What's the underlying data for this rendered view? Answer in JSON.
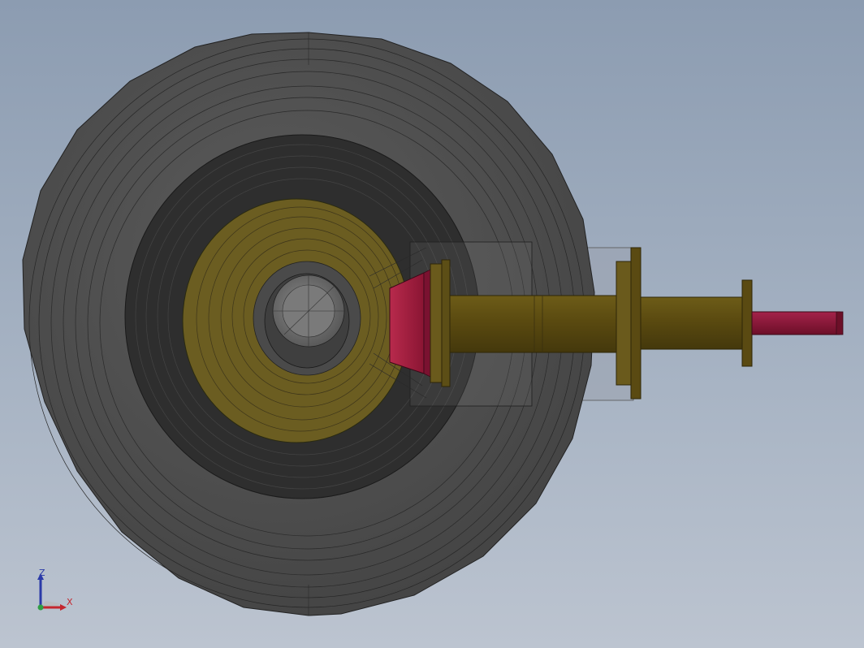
{
  "viewport": {
    "background_top": "#8c9cb1",
    "background_bottom": "#bcc4d0"
  },
  "model": {
    "parts": [
      {
        "name": "outer-tire-housing",
        "color": "#4f4f4f"
      },
      {
        "name": "inner-wheel-well",
        "color": "#2f2f2f"
      },
      {
        "name": "hub-disc",
        "color": "#6e5f22"
      },
      {
        "name": "center-bore",
        "color": "#5f5f5f"
      },
      {
        "name": "cone-adapter",
        "color": "#a1203f"
      },
      {
        "name": "shaft",
        "color": "#5c4c12"
      },
      {
        "name": "flange",
        "color": "#6a5a1c"
      },
      {
        "name": "drive-pin",
        "color": "#8e1736"
      }
    ]
  },
  "triad": {
    "z_label": "Z",
    "x_label": "X",
    "z_color": "#2a3aa8",
    "x_color": "#c4262e",
    "y_color": "#2f9e44"
  }
}
